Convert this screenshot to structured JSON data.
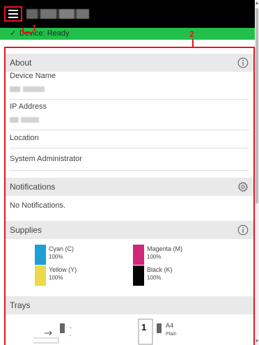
{
  "header": {
    "menu_icon": "hamburger-menu-icon",
    "device_name_redacted": ""
  },
  "status": {
    "text": "Device: Ready",
    "icon": "check-icon",
    "color": "#22c04a"
  },
  "callouts": {
    "one": "1",
    "two": "2"
  },
  "about": {
    "title": "About",
    "icon": "info-icon",
    "device_name_label": "Device Name",
    "ip_address_label": "IP Address",
    "location_label": "Location",
    "system_admin_label": "System Administrator"
  },
  "notifications": {
    "title": "Notifications",
    "icon": "gear-icon",
    "empty_text": "No Notifications."
  },
  "supplies": {
    "title": "Supplies",
    "icon": "info-icon",
    "items": [
      {
        "name": "Cyan (C)",
        "level": "100%",
        "color": "#1e9fd6"
      },
      {
        "name": "Magenta (M)",
        "level": "100%",
        "color": "#d0277d"
      },
      {
        "name": "Yellow (Y)",
        "level": "100%",
        "color": "#ecd84a"
      },
      {
        "name": "Black (K)",
        "level": "100%",
        "color": "#050505"
      }
    ]
  },
  "trays": {
    "title": "Trays",
    "items": [
      {
        "icon": "bypass-tray-icon",
        "size": "-",
        "type": "-"
      },
      {
        "icon": "tray-1-icon",
        "number": "1",
        "size": "A4",
        "type": "Plain"
      }
    ]
  },
  "colors": {
    "accent_red": "#e8141c",
    "topbar": "#000000",
    "section_bg": "#e9e9e9"
  }
}
